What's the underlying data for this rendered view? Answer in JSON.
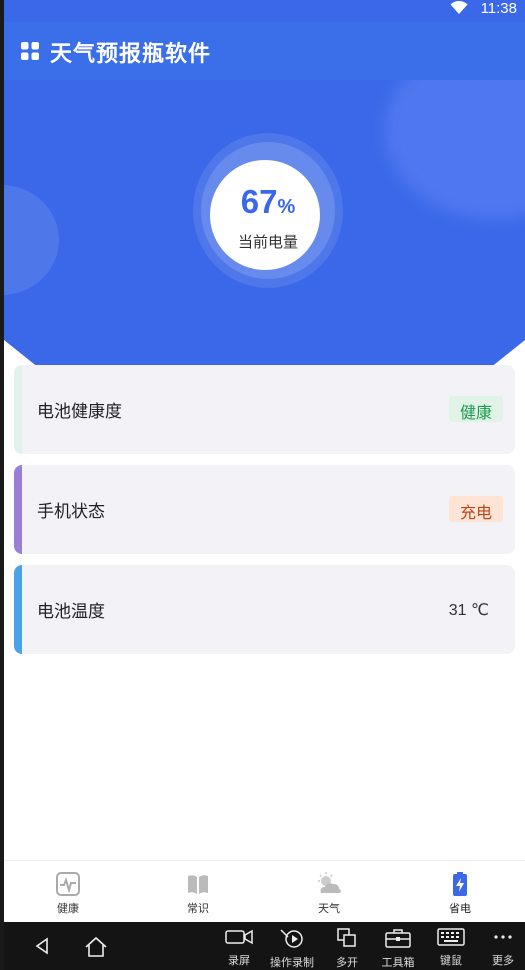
{
  "status": {
    "time": "11:38"
  },
  "app": {
    "title": "天气预报瓶软件"
  },
  "battery": {
    "percent_value": "67",
    "percent_unit": "%",
    "label": "当前电量"
  },
  "cards": [
    {
      "title": "电池健康度",
      "value": "健康",
      "value_color": "#1e9b4e",
      "value_bg": "#dff3e6",
      "accent": "#dff3ec"
    },
    {
      "title": "手机状态",
      "value": "充电",
      "value_color": "#b8481a",
      "value_bg": "#fde4d4",
      "accent": "#9b7ed8"
    },
    {
      "title": "电池温度",
      "value": "31 ℃",
      "accent": "#4aa3e8"
    }
  ],
  "nav": [
    {
      "label": "健康",
      "icon": "heart-monitor-icon"
    },
    {
      "label": "常识",
      "icon": "book-icon"
    },
    {
      "label": "天气",
      "icon": "weather-icon"
    },
    {
      "label": "省电",
      "icon": "battery-charge-icon"
    }
  ],
  "system": {
    "tools": [
      {
        "label": "录屏",
        "icon": "screen-record-icon"
      },
      {
        "label": "操作录制",
        "icon": "macro-record-icon"
      },
      {
        "label": "多开",
        "icon": "multi-open-icon"
      },
      {
        "label": "工具箱",
        "icon": "toolbox-icon"
      },
      {
        "label": "键鼠",
        "icon": "keyboard-icon"
      },
      {
        "label": "更多",
        "icon": "more-icon"
      }
    ]
  },
  "colors": {
    "primary": "#3a68e8",
    "active_nav": "#3a68e8"
  }
}
